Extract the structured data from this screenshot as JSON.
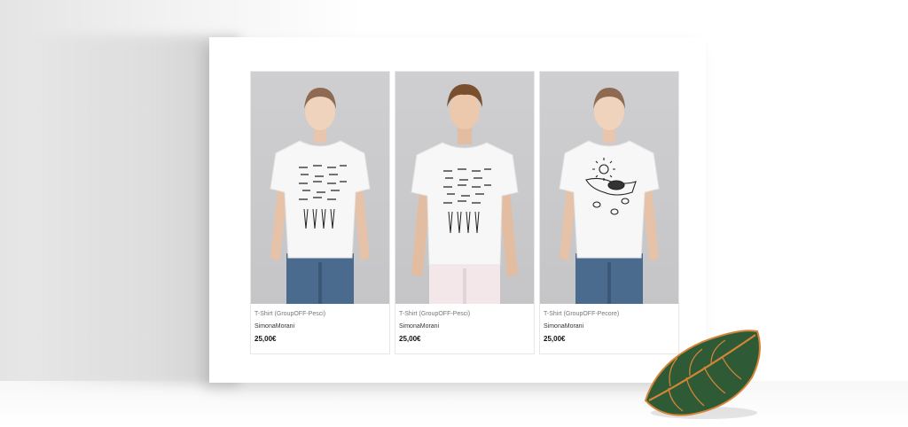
{
  "products": [
    {
      "title": "T-Shirt (GroupOFF-Pesci)",
      "brand": "SimonaMorani",
      "price": "25,00€"
    },
    {
      "title": "T-Shirt (GroupOFF-Pesci)",
      "brand": "SimonaMorani",
      "price": "25,00€"
    },
    {
      "title": "T-Shirt (GroupOFF-Pecore)",
      "brand": "SimonaMorani",
      "price": "25,00€"
    }
  ],
  "colors": {
    "background": "#ffffff",
    "photo_background": "#c8c8cb",
    "shirt": "#f7f7f7",
    "jeans": "#4a6a8e",
    "light_pants": "#f3e7ea",
    "hair_female": "#8f6a52",
    "hair_male": "#7a4f2d",
    "leaf_green": "#2e5a35",
    "leaf_orange": "#d48436"
  }
}
